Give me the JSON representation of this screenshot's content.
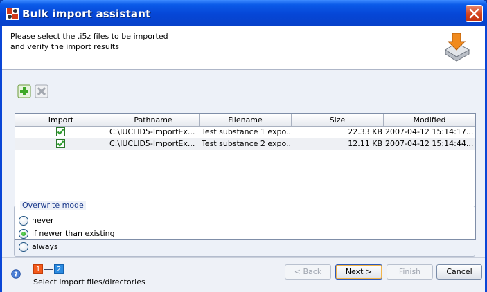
{
  "window": {
    "title": "Bulk import assistant",
    "icons": {
      "app": "iuclid-app-icon",
      "close": "close-icon"
    }
  },
  "header": {
    "line1": "Please select the .i5z files to be imported",
    "line2": "and verify the import results",
    "illustration": "import-tray-icon"
  },
  "toolbar": {
    "add": {
      "icon": "add-icon",
      "enabled": true
    },
    "remove": {
      "icon": "remove-icon",
      "enabled": false
    }
  },
  "table": {
    "columns": [
      "Import",
      "Pathname",
      "Filename",
      "Size",
      "Modified"
    ],
    "rows": [
      {
        "import": true,
        "pathname": "C:\\IUCLID5-ImportEx...",
        "filename": "Test substance 1 expo...",
        "size": "22.33 KB",
        "modified": "2007-04-12 15:14:17..."
      },
      {
        "import": true,
        "pathname": "C:\\IUCLID5-ImportEx...",
        "filename": "Test substance 2 expo...",
        "size": "12.11 KB",
        "modified": "2007-04-12 15:14:44..."
      }
    ]
  },
  "overwrite": {
    "legend": "Overwrite mode",
    "options": [
      "never",
      "if newer than existing",
      "always"
    ],
    "selected": "if newer than existing"
  },
  "footer": {
    "steps": [
      "1",
      "2"
    ],
    "current_step": "1",
    "caption": "Select import files/directories",
    "buttons": {
      "back": "< Back",
      "next": "Next >",
      "finish": "Finish",
      "cancel": "Cancel"
    }
  },
  "colors": {
    "titlebar": "#0646d6",
    "step1": "#f35a1b",
    "step2": "#2a8ae0",
    "check": "#2e9e2e"
  }
}
